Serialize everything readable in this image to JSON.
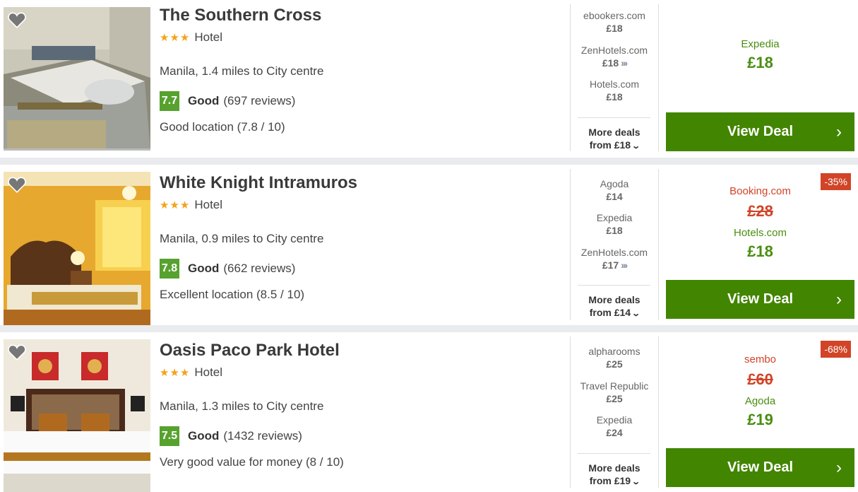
{
  "hotels": [
    {
      "name": "The Southern Cross",
      "stars": 3,
      "type": "Hotel",
      "location": "Manila, 1.4 miles to City centre",
      "score": "7.7",
      "grade": "Good",
      "reviews": "(697 reviews)",
      "extra": "Good location (7.8 / 10)",
      "providers": [
        {
          "name": "ebookers.com",
          "price": "£18",
          "arrows": ""
        },
        {
          "name": "ZenHotels.com",
          "price": "£18",
          "arrows": "›››"
        },
        {
          "name": "Hotels.com",
          "price": "£18",
          "arrows": ""
        }
      ],
      "more_line1": "More deals",
      "more_line2": "from £18",
      "badge": "",
      "old_provider": "",
      "old_price": "",
      "best_provider": "Expedia",
      "best_price": "£18",
      "button": "View Deal"
    },
    {
      "name": "White Knight Intramuros",
      "stars": 3,
      "type": "Hotel",
      "location": "Manila, 0.9 miles to City centre",
      "score": "7.8",
      "grade": "Good",
      "reviews": "(662 reviews)",
      "extra": "Excellent location (8.5 / 10)",
      "providers": [
        {
          "name": "Agoda",
          "price": "£14",
          "arrows": ""
        },
        {
          "name": "Expedia",
          "price": "£18",
          "arrows": ""
        },
        {
          "name": "ZenHotels.com",
          "price": "£17",
          "arrows": "›››"
        }
      ],
      "more_line1": "More deals",
      "more_line2": "from £14",
      "badge": "-35%",
      "old_provider": "Booking.com",
      "old_price": "£28",
      "best_provider": "Hotels.com",
      "best_price": "£18",
      "button": "View Deal"
    },
    {
      "name": "Oasis Paco Park Hotel",
      "stars": 3,
      "type": "Hotel",
      "location": "Manila, 1.3 miles to City centre",
      "score": "7.5",
      "grade": "Good",
      "reviews": "(1432 reviews)",
      "extra": "Very good value for money (8 / 10)",
      "providers": [
        {
          "name": "alpharooms",
          "price": "£25",
          "arrows": ""
        },
        {
          "name": "Travel Republic",
          "price": "£25",
          "arrows": ""
        },
        {
          "name": "Expedia",
          "price": "£24",
          "arrows": ""
        }
      ],
      "more_line1": "More deals",
      "more_line2": "from £19",
      "badge": "-68%",
      "old_provider": "sembo",
      "old_price": "£60",
      "best_provider": "Agoda",
      "best_price": "£19",
      "button": "View Deal"
    }
  ],
  "icons": {
    "favorite": "heart-icon",
    "star": "star-icon",
    "more_arrow": "chevron-down-icon",
    "deal_arrow": "chevron-right-icon"
  },
  "colors": {
    "score_bg": "#57a22e",
    "button_bg": "#428500",
    "price_green": "#4a8d10",
    "discount_red": "#d14427",
    "star": "#f2a31b"
  }
}
